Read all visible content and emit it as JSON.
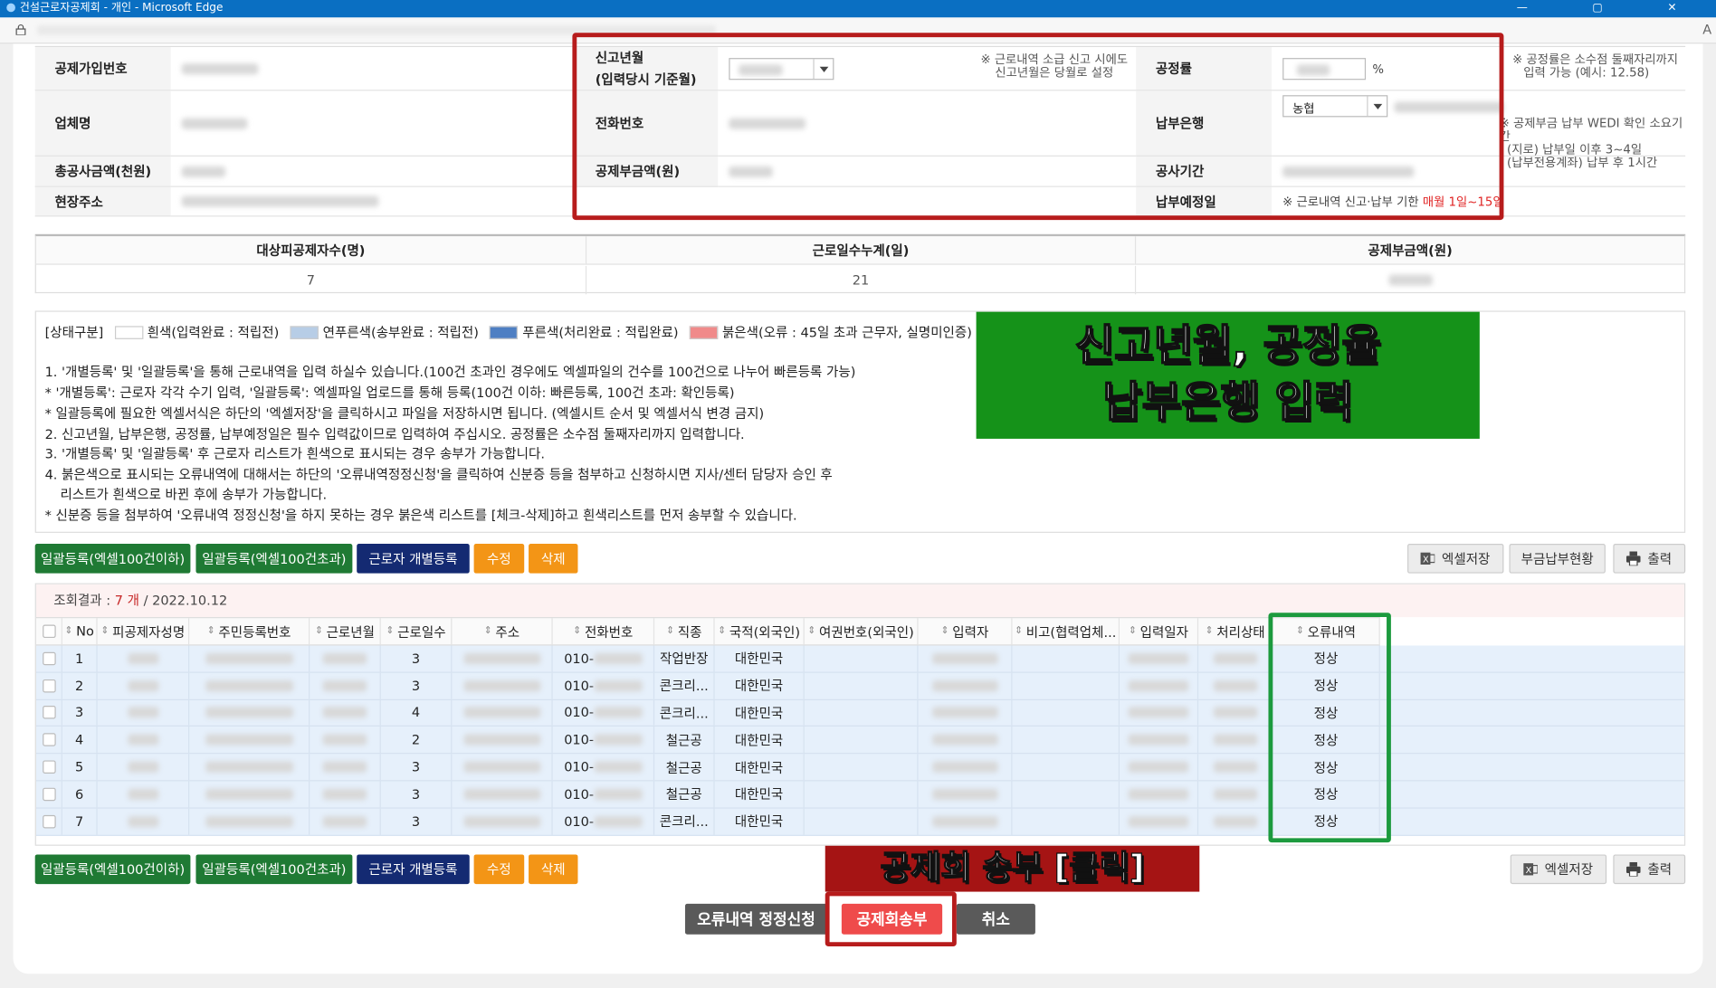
{
  "window": {
    "title": "건설근로자공제회 - 개인 - Microsoft Edge",
    "controls": "— ▢ ✕",
    "right_glyph": "A"
  },
  "info": {
    "join_no_label": "공제가입번호",
    "company_label": "업체명",
    "total_amount_label": "총공사금액(천원)",
    "site_address_label": "현장주소",
    "report_month_label_1": "신고년월",
    "report_month_label_2": "(입력당시 기준월)",
    "phone_label": "전화번호",
    "premium_label": "공제부금액(원)",
    "report_month_note_1": "※ 근로내역 소급 신고 시에도",
    "report_month_note_2": "신고년월은 당월로 설정",
    "rate_label": "공정률",
    "rate_unit": "%",
    "rate_note_1": "※ 공정률은 소수점 둘째자리까지",
    "rate_note_2": "입력 가능 (예시: 12.58)",
    "bank_label": "납부은행",
    "bank_value": "농협",
    "bank_note_1": "※ 공제부금 납부 WEDI 확인 소요기간",
    "bank_note_2": "· (지로) 납부일 이후 3~4일",
    "bank_note_3": "· (납부전용계좌) 납부 후 1시간",
    "period_label": "공사기간",
    "due_label": "납부예정일",
    "due_note": "※ 근로내역 신고·납부 기한",
    "due_highlight": "매월 1일~15일"
  },
  "summary": {
    "headers": [
      "대상피공제자수(명)",
      "근로일수누계(일)",
      "공제부금액(원)"
    ],
    "values": [
      "7",
      "21",
      ""
    ]
  },
  "legend": {
    "label": "[상태구분]",
    "items": [
      {
        "text": "흰색(입력완료 : 적립전)",
        "color": "#ffffff"
      },
      {
        "text": "연푸른색(송부완료 : 적립전)",
        "color": "#b7cde6"
      },
      {
        "text": "푸른색(처리완료 : 적립완료)",
        "color": "#4e7fc3"
      },
      {
        "text": "붉은색(오류 : 45일 초과 근무자, 실명미인증)",
        "color": "#f08a8a"
      }
    ]
  },
  "instructions": [
    "1. '개별등록' 및 '일괄등록'을 통해 근로내역을 입력 하실수 있습니다.(100건 초과인 경우에도 엑셀파일의 건수를 100건으로 나누어 빠른등록 가능)",
    " * '개별등록': 근로자 각각 수기 입력, '일괄등록': 엑셀파일 업로드를 통해 등록(100건 이하: 빠른등록, 100건 초과: 확인등록)",
    " * 일괄등록에 필요한 엑셀서식은 하단의 '엑셀저장'을 클릭하시고 파일을 저장하시면 됩니다. (엑셀시트 순서 및 엑셀서식 변경 금지)",
    "2. 신고년월, 납부은행, 공정률, 납부예정일은 필수 입력값이므로 입력하여 주십시오. 공정률은 소수점 둘째자리까지 입력합니다.",
    "3. '개별등록' 및 '일괄등록' 후 근로자 리스트가 흰색으로 표시되는 경우 송부가 가능합니다.",
    "4. 붉은색으로 표시되는 오류내역에 대해서는 하단의 '오류내역정정신청'을 클릭하여 신분증 등을 첨부하고 신청하시면 지사/센터 담당자 승인 후",
    "    리스트가 흰색으로 바뀐 후에 송부가 가능합니다.",
    " * 신분증 등을 첨부하여 '오류내역 정정신청'을 하지 못하는 경우 붉은색 리스트를 [체크-삭제]하고 흰색리스트를 먼저 송부할 수 있습니다."
  ],
  "callout_main": {
    "line1": "신고년월, 공정율",
    "line2": "납부은행 입력"
  },
  "callout_send": "공제회 송부 [클릭]",
  "buttons": {
    "bulk_small": "일괄등록(엑셀100건이하)",
    "bulk_large": "일괄등록(엑셀100건초과)",
    "individual": "근로자 개별등록",
    "edit": "수정",
    "delete": "삭제",
    "excel": "엑셀저장",
    "payment_status": "부금납부현황",
    "print": "출력",
    "error_request": "오류내역 정정신청",
    "send": "공제회송부",
    "cancel": "취소"
  },
  "grid": {
    "count_label": "조회결과 : ",
    "count_value": "7 개",
    "count_date": " / 2022.10.12",
    "columns": [
      "No",
      "피공제자성명",
      "주민등록번호",
      "근로년월",
      "근로일수",
      "주소",
      "전화번호",
      "직종",
      "국적(외국인)",
      "여권번호(외국인)",
      "입력자",
      "비고(협력업체...",
      "입력일자",
      "처리상태",
      "오류내역"
    ],
    "rows": [
      {
        "no": "1",
        "days": "3",
        "phone": "010-",
        "job": "작업반장",
        "nation": "대한민국",
        "err": "정상"
      },
      {
        "no": "2",
        "days": "3",
        "phone": "010-",
        "job": "콘크리...",
        "nation": "대한민국",
        "err": "정상"
      },
      {
        "no": "3",
        "days": "4",
        "phone": "010-",
        "job": "콘크리...",
        "nation": "대한민국",
        "err": "정상"
      },
      {
        "no": "4",
        "days": "2",
        "phone": "010-",
        "job": "철근공",
        "nation": "대한민국",
        "err": "정상"
      },
      {
        "no": "5",
        "days": "3",
        "phone": "010-",
        "job": "철근공",
        "nation": "대한민국",
        "err": "정상"
      },
      {
        "no": "6",
        "days": "3",
        "phone": "010-",
        "job": "철근공",
        "nation": "대한민국",
        "err": "정상"
      },
      {
        "no": "7",
        "days": "3",
        "phone": "010-",
        "job": "콘크리...",
        "nation": "대한민국",
        "err": "정상"
      }
    ]
  },
  "colors": {
    "highlight_red": "#b71c1c",
    "highlight_green": "#1c9a3e",
    "send_button": "#ef4b4b",
    "callout_green": "#159219",
    "callout_red": "#a51414"
  }
}
